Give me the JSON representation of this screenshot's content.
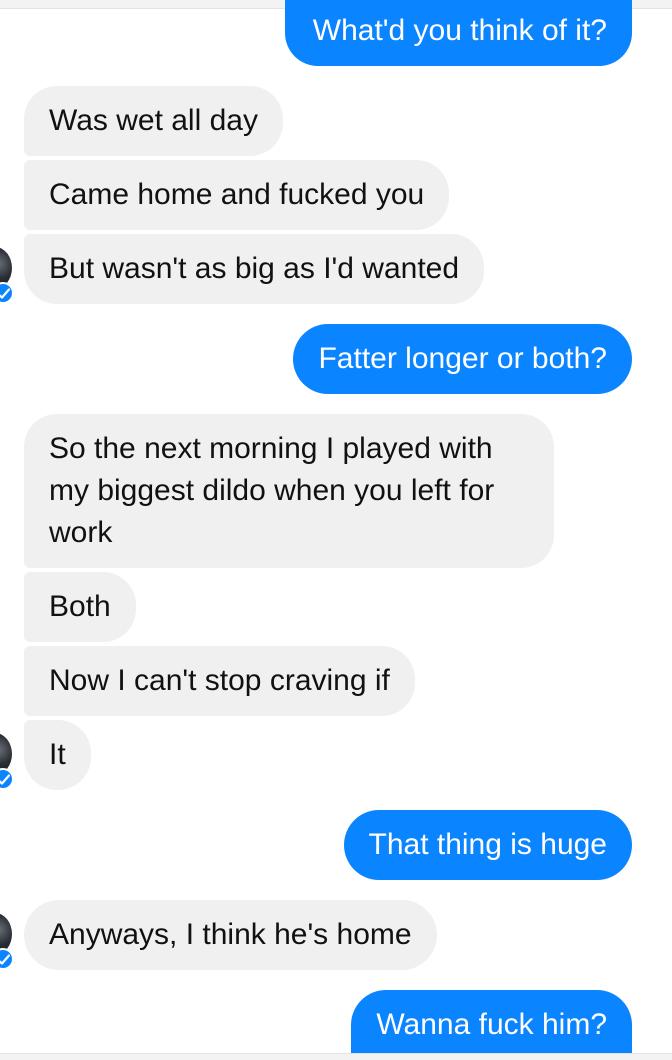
{
  "messages": [
    {
      "sender": "me",
      "text": "What'd you think of it?"
    },
    {
      "sender": "them",
      "text": "Was wet all day"
    },
    {
      "sender": "them",
      "text": "Came home and fucked you"
    },
    {
      "sender": "them",
      "text": "But wasn't as big as I'd wanted"
    },
    {
      "sender": "me",
      "text": "Fatter longer or both?"
    },
    {
      "sender": "them",
      "text": "So the next morning I played with my biggest dildo when you left for work"
    },
    {
      "sender": "them",
      "text": "Both"
    },
    {
      "sender": "them",
      "text": "Now I can't stop craving if"
    },
    {
      "sender": "them",
      "text": "It"
    },
    {
      "sender": "me",
      "text": "That thing is huge"
    },
    {
      "sender": "them",
      "text": "Anyways, I think he's home"
    },
    {
      "sender": "me",
      "text": "Wanna fuck him?"
    }
  ],
  "colors": {
    "outgoing_bubble": "#0b84ff",
    "incoming_bubble": "#f0f0f0",
    "background": "#ffffff"
  },
  "icons": [
    "contact-avatar-icon",
    "messenger-verified-check-icon"
  ]
}
